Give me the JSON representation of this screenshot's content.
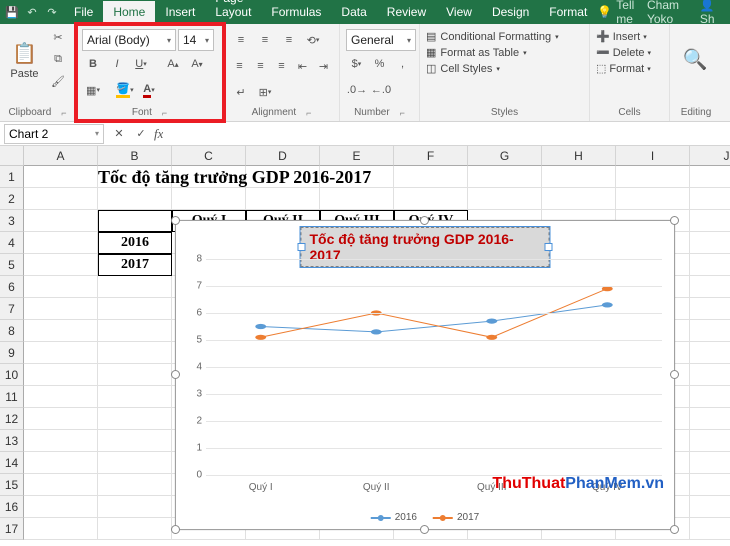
{
  "titlebar": {
    "tabs": [
      "File",
      "Home",
      "Insert",
      "Page Layout",
      "Formulas",
      "Data",
      "Review",
      "View",
      "Design",
      "Format"
    ],
    "active_tab": "Home",
    "tellme": "Tell me",
    "user": "Cham Yoko",
    "share": "Sh"
  },
  "ribbon": {
    "clipboard": {
      "paste": "Paste",
      "label": "Clipboard"
    },
    "font": {
      "name": "Arial (Body)",
      "size": "14",
      "label": "Font"
    },
    "alignment": {
      "label": "Alignment"
    },
    "number": {
      "format": "General",
      "label": "Number"
    },
    "styles": {
      "cond": "Conditional Formatting",
      "table": "Format as Table",
      "cell": "Cell Styles",
      "label": "Styles"
    },
    "cells": {
      "insert": "Insert",
      "delete": "Delete",
      "format": "Format",
      "label": "Cells"
    },
    "editing": {
      "label": "Editing"
    }
  },
  "namebox": "Chart 2",
  "columns": [
    "A",
    "B",
    "C",
    "D",
    "E",
    "F",
    "G",
    "H",
    "I",
    "J"
  ],
  "rows": [
    "1",
    "2",
    "3",
    "4",
    "5",
    "6",
    "7",
    "8",
    "9",
    "10",
    "11",
    "12",
    "13",
    "14",
    "15",
    "16",
    "17"
  ],
  "sheet": {
    "title": "Tốc độ tăng trưởng GDP 2016-2017",
    "headers": [
      "Quý I",
      "Quý II",
      "Quý III",
      "Quý IV"
    ],
    "row_labels": [
      "2016",
      "2017"
    ]
  },
  "chart_data": {
    "type": "line",
    "title": "Tốc độ tăng trưởng GDP 2016-2017",
    "categories": [
      "Quý I",
      "Quý II",
      "Quý III",
      "Quý IV"
    ],
    "series": [
      {
        "name": "2016",
        "values": [
          5.5,
          5.3,
          5.7,
          6.3
        ],
        "color": "#5b9bd5"
      },
      {
        "name": "2017",
        "values": [
          5.1,
          6.0,
          5.1,
          6.9
        ],
        "color": "#ed7d31"
      }
    ],
    "ylabel": "",
    "xlabel": "",
    "ylim": [
      0,
      8
    ],
    "yticks": [
      0,
      1,
      2,
      3,
      4,
      5,
      6,
      7,
      8
    ]
  },
  "watermark": {
    "part1": "ThuThuat",
    "part2": "PhanMem",
    "part3": ".vn"
  }
}
